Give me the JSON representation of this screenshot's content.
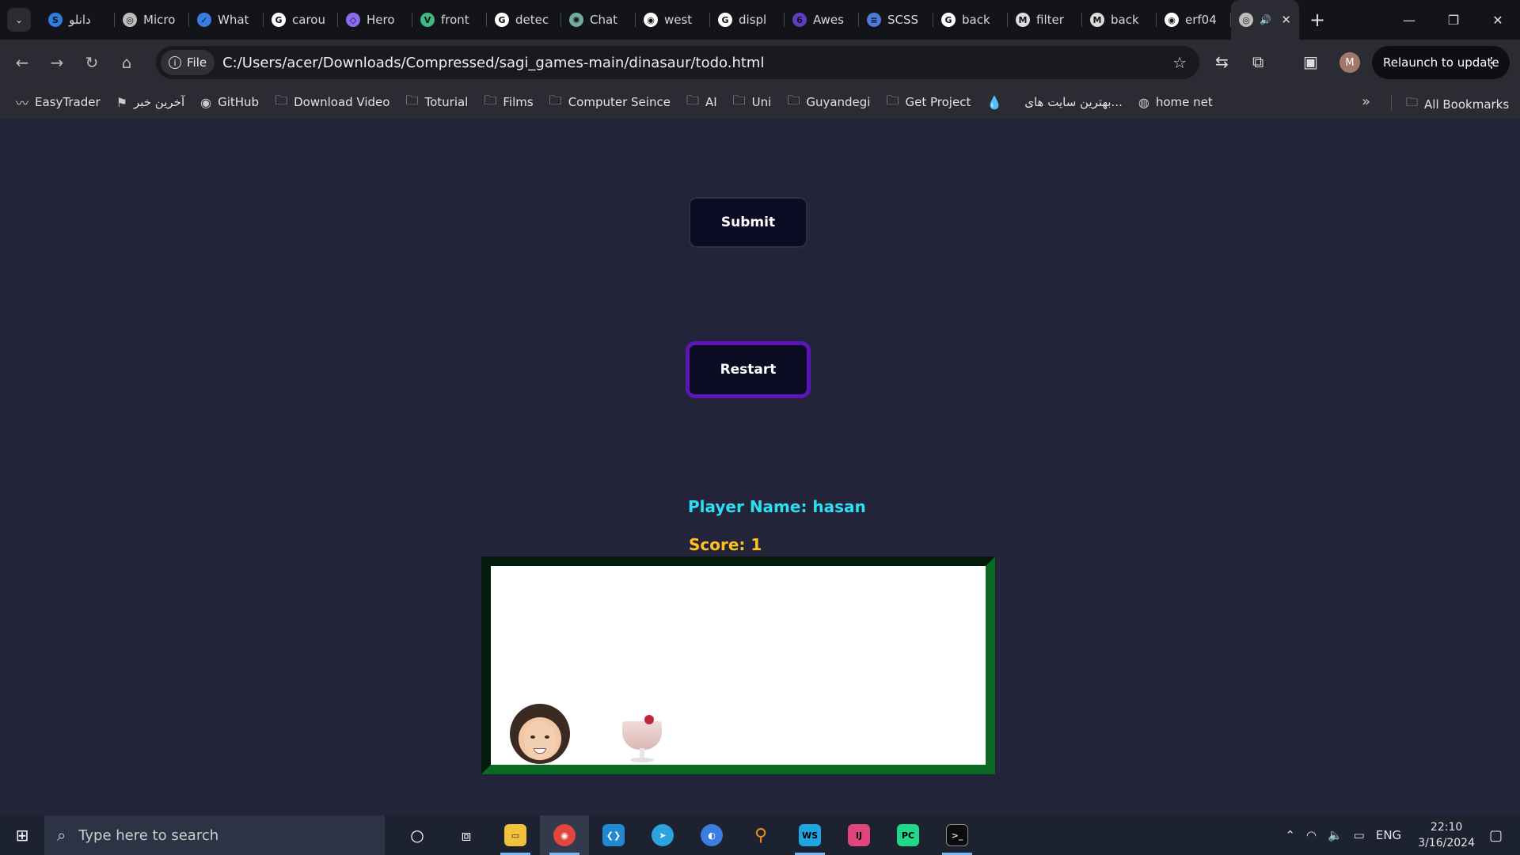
{
  "browser": {
    "tabs": [
      {
        "title": "دانلو",
        "favicon_color": "#2f7de1",
        "favicon_glyph": "S"
      },
      {
        "title": "Micro",
        "favicon_color": "#bdbdbd",
        "favicon_glyph": "◎"
      },
      {
        "title": "What",
        "favicon_color": "#3a7de0",
        "favicon_glyph": "✓"
      },
      {
        "title": "carou",
        "favicon_color": "#ffffff",
        "favicon_glyph": "G"
      },
      {
        "title": "Hero",
        "favicon_color": "#8b6cf0",
        "favicon_glyph": "◇"
      },
      {
        "title": "front",
        "favicon_color": "#41b883",
        "favicon_glyph": "V"
      },
      {
        "title": "detec",
        "favicon_color": "#ffffff",
        "favicon_glyph": "G"
      },
      {
        "title": "Chat",
        "favicon_color": "#74aa9c",
        "favicon_glyph": "✺"
      },
      {
        "title": "west",
        "favicon_color": "#ffffff",
        "favicon_glyph": "◉"
      },
      {
        "title": "displ",
        "favicon_color": "#ffffff",
        "favicon_glyph": "G"
      },
      {
        "title": "Awes",
        "favicon_color": "#5e3cc4",
        "favicon_glyph": "6"
      },
      {
        "title": "SCSS",
        "favicon_color": "#4a7bd6",
        "favicon_glyph": "≡"
      },
      {
        "title": "back",
        "favicon_color": "#ffffff",
        "favicon_glyph": "G"
      },
      {
        "title": "filter",
        "favicon_color": "#dddddd",
        "favicon_glyph": "M"
      },
      {
        "title": "back",
        "favicon_color": "#dddddd",
        "favicon_glyph": "M"
      },
      {
        "title": "erf04",
        "favicon_color": "#ffffff",
        "favicon_glyph": "◉"
      }
    ],
    "active_tab_audio": "🔊",
    "active_tab_close": "✕",
    "new_tab": "+",
    "window": {
      "minimize": "—",
      "restore": "❐",
      "close": "✕"
    },
    "nav": {
      "back": "←",
      "forward": "→",
      "reload": "↻",
      "home": "⌂"
    },
    "address": {
      "chip": "File",
      "url": "C:/Users/acer/Downloads/Compressed/sagi_games-main/dinasaur/todo.html"
    },
    "profile_initial": "M",
    "relaunch_label": "Relaunch to update",
    "bookmarks": [
      {
        "label": "EasyTrader",
        "icon": "trend-icon"
      },
      {
        "label": "آخرین خبر",
        "icon": "news-icon"
      },
      {
        "label": "GitHub",
        "icon": "github-icon"
      },
      {
        "label": "Download Video",
        "icon": "folder-icon"
      },
      {
        "label": "Toturial",
        "icon": "folder-icon"
      },
      {
        "label": "Films",
        "icon": "folder-icon"
      },
      {
        "label": "Computer Seince",
        "icon": "folder-icon"
      },
      {
        "label": "AI",
        "icon": "folder-icon"
      },
      {
        "label": "Uni",
        "icon": "folder-icon"
      },
      {
        "label": "Guyandegi",
        "icon": "folder-icon"
      },
      {
        "label": "Get Project",
        "icon": "folder-icon"
      },
      {
        "label": "",
        "icon": "drop-icon"
      },
      {
        "label": "بهترین سایت های...",
        "icon": "none"
      },
      {
        "label": "home net",
        "icon": "globe-icon"
      }
    ],
    "bookmarks_more": "»",
    "all_bookmarks": "All Bookmarks"
  },
  "page": {
    "submit_label": "Submit",
    "restart_label": "Restart",
    "player_name": "Player Name: hasan",
    "score": "Score: 1"
  },
  "taskbar": {
    "search_placeholder": "Type here to search",
    "language": "ENG",
    "time": "22:10",
    "date": "3/16/2024"
  }
}
